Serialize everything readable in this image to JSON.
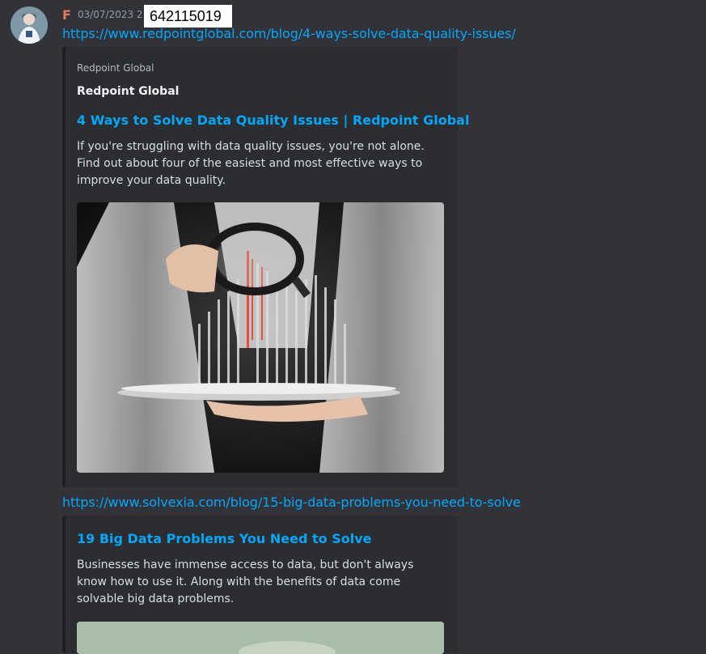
{
  "message": {
    "username": "F",
    "timestamp": "03/07/2023 2",
    "redacted_text": "642115019"
  },
  "links": [
    "https://www.redpointglobal.com/blog/4-ways-solve-data-quality-issues/",
    "https://www.solvexia.com/blog/15-big-data-problems-you-need-to-solve"
  ],
  "embed1": {
    "provider": "Redpoint Global",
    "author": "Redpoint Global",
    "title": "4 Ways to Solve Data Quality Issues | Redpoint Global",
    "description": "If you're struggling with data quality issues, you're not alone. Find out about four of the easiest and most effective ways to improve your data quality."
  },
  "embed2": {
    "title": "19 Big Data Problems You Need to Solve",
    "description": "Businesses have immense access to data, but don't always know how to use it. Along with the benefits of data come solvable big data problems."
  },
  "colors": {
    "background": "#313338",
    "embed_bg": "#2b2d31",
    "link": "#00a8fc",
    "username": "#e07a5f"
  }
}
